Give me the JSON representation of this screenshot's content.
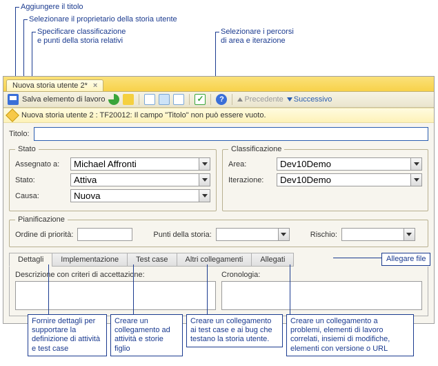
{
  "callouts": {
    "title": "Aggiungere il titolo",
    "owner": "Selezionare il proprietario della storia utente",
    "classif": "Specificare classificazione\ne punti della storia relativi",
    "paths": "Selezionare i percorsi\ndi area e iterazione",
    "attach": "Allegare file"
  },
  "tab": {
    "label": "Nuova storia utente 2*"
  },
  "toolbar": {
    "save": "Salva elemento di lavoro",
    "prev": "Precedente",
    "next": "Successivo"
  },
  "message": "Nuova storia utente 2 : TF20012: Il campo \"Titolo\" non può essere vuoto.",
  "form": {
    "title_label": "Titolo:",
    "title_value": "",
    "stato": {
      "legend": "Stato",
      "assegnato_label": "Assegnato a:",
      "assegnato_value": "Michael Affronti",
      "stato_label": "Stato:",
      "stato_value": "Attiva",
      "causa_label": "Causa:",
      "causa_value": "Nuova"
    },
    "classificazione": {
      "legend": "Classificazione",
      "area_label": "Area:",
      "area_value": "Dev10Demo",
      "iter_label": "Iterazione:",
      "iter_value": "Dev10Demo"
    },
    "pianificazione": {
      "legend": "Pianificazione",
      "ordine_label": "Ordine di priorità:",
      "ordine_value": "",
      "punti_label": "Punti della storia:",
      "punti_value": "",
      "rischio_label": "Rischio:",
      "rischio_value": ""
    },
    "tabs": {
      "dettagli": "Dettagli",
      "implementazione": "Implementazione",
      "testcase": "Test case",
      "altri": "Altri collegamenti",
      "allegati": "Allegati"
    },
    "details": {
      "desc_label": "Descrizione con criteri di accettazione:",
      "cron_label": "Cronologia:"
    }
  },
  "bottom": {
    "dettagli": "Fornire dettagli\nper supportare\nla definizione di\nattività e test case",
    "impl": "Creare un\ncollegamento\nad attività e\nstorie figlio",
    "test": "Creare un collegamento\nai test case e ai bug\nche testano la storia\nutente.",
    "altri": "Creare un collegamento a\nproblemi, elementi di lavoro\ncorrelati, insiemi di modifiche,\nelementi con versione o URL"
  }
}
